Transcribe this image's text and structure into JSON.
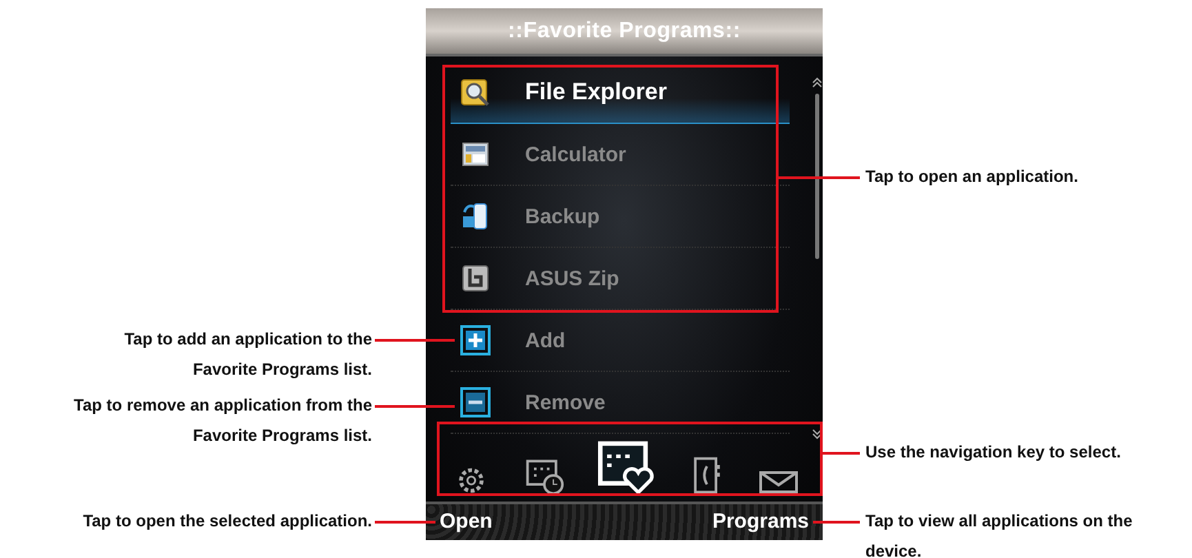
{
  "screen": {
    "title": "::Favorite Programs::",
    "items": [
      {
        "label": "File Explorer",
        "kind": "search",
        "selected": true
      },
      {
        "label": "Calculator",
        "kind": "calculator",
        "selected": false
      },
      {
        "label": "Backup",
        "kind": "backup",
        "selected": false
      },
      {
        "label": "ASUS Zip",
        "kind": "zip",
        "selected": false
      },
      {
        "label": "Add",
        "kind": "add",
        "selected": false
      },
      {
        "label": "Remove",
        "kind": "remove",
        "selected": false
      }
    ],
    "dock": [
      {
        "kind": "gear",
        "selected": false
      },
      {
        "kind": "calendar-clock",
        "selected": false
      },
      {
        "kind": "calendar-heart",
        "selected": true
      },
      {
        "kind": "contacts",
        "selected": false
      },
      {
        "kind": "mail",
        "selected": false
      }
    ],
    "softkeys": [
      "Open",
      "Programs"
    ]
  },
  "left_callouts": [
    "Tap to add an application to the Favorite Programs list.",
    "Tap to remove an application from the Favorite Programs list.",
    "Tap to open the selected application."
  ],
  "right_callouts": [
    "Tap to open an application.",
    "Use the navigation key to select.",
    "Tap to view all applications on the device."
  ]
}
